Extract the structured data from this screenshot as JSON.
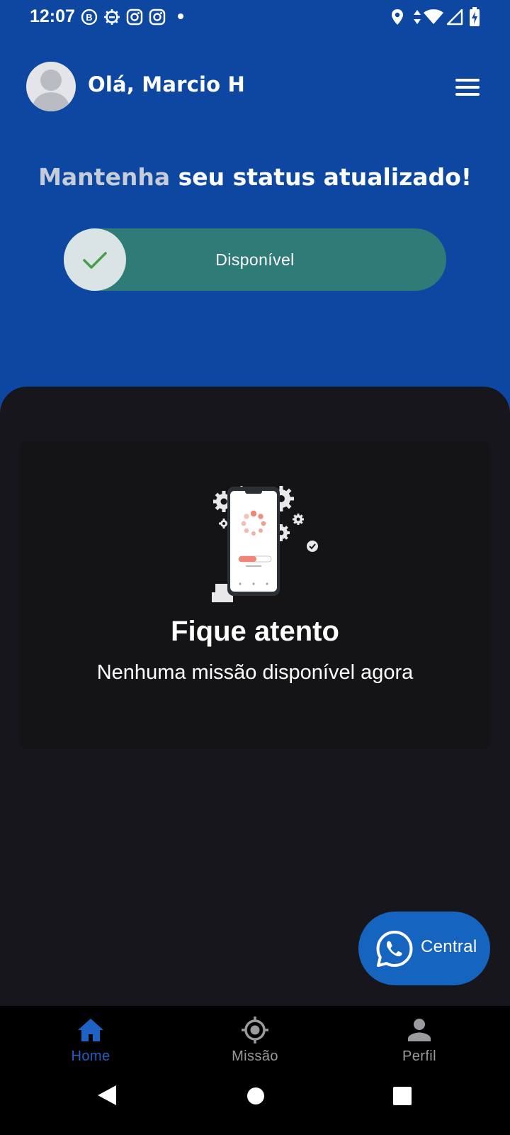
{
  "status_bar": {
    "time": "12:07",
    "left_icons": [
      "b-badge-icon",
      "gear-notification-icon",
      "instagram-icon",
      "instagram-icon",
      "dot-icon"
    ],
    "right_icons": [
      "location-icon",
      "data-arrows-icon",
      "wifi-icon",
      "signal-icon",
      "battery-charging-icon"
    ]
  },
  "header": {
    "greeting": "Olá, Marcio H",
    "menu_icon": "hamburger-menu-icon"
  },
  "status_section": {
    "title_start": "Mantenha",
    "title_rest": " seu status atualizado!",
    "toggle_label": "Disponível",
    "toggle_icon": "check-icon"
  },
  "empty_state": {
    "title": "Fique atento",
    "subtitle": "Nenhuma missão disponível agora"
  },
  "fab": {
    "label": "Central",
    "icon": "whatsapp-icon"
  },
  "bottom_nav": {
    "items": [
      {
        "label": "Home",
        "icon": "home-icon",
        "active": true
      },
      {
        "label": "Missão",
        "icon": "target-icon",
        "active": false
      },
      {
        "label": "Perfil",
        "icon": "person-icon",
        "active": false
      }
    ]
  },
  "colors": {
    "primary": "#0d47a1",
    "toggle": "#2e7b77",
    "nav_active": "#1e63c4",
    "nav_inactive": "#9a9a9f",
    "fab": "#1565c0"
  }
}
